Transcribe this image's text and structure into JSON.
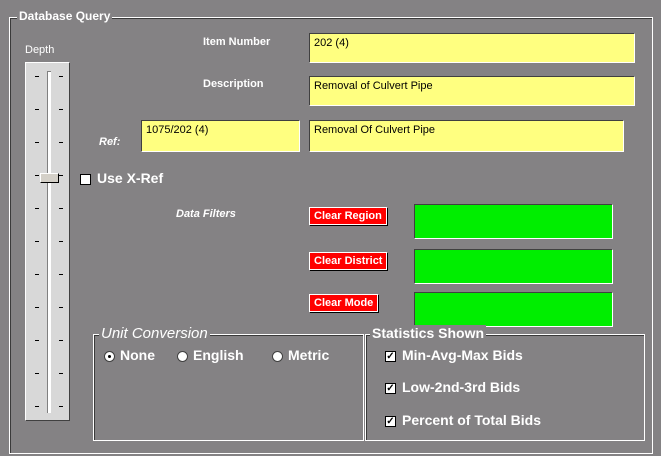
{
  "groups": {
    "database_query": "Database Query",
    "unit_conversion": "Unit Conversion",
    "statistics_shown": "Statistics Shown"
  },
  "slider": {
    "label": "Depth",
    "value_fraction": 0.31
  },
  "item_number": {
    "label": "Item Number",
    "value": "202 (4)"
  },
  "description": {
    "label": "Description",
    "value": "Removal of Culvert Pipe"
  },
  "ref": {
    "label": "Ref:",
    "code": "1075/202 (4)",
    "description": "Removal Of Culvert Pipe"
  },
  "use_xref": {
    "label": "Use X-Ref",
    "checked": false
  },
  "data_filters": {
    "label": "Data Filters",
    "buttons": [
      {
        "label": "Clear Region",
        "value": ""
      },
      {
        "label": "Clear District",
        "value": ""
      },
      {
        "label": "Clear Mode",
        "value": ""
      }
    ]
  },
  "unit_options": [
    {
      "label": "None",
      "selected": true
    },
    {
      "label": "English",
      "selected": false
    },
    {
      "label": "Metric",
      "selected": false
    }
  ],
  "statistics": [
    {
      "label": "Min-Avg-Max Bids",
      "checked": true
    },
    {
      "label": "Low-2nd-3rd Bids",
      "checked": true
    },
    {
      "label": "Percent of Total Bids",
      "checked": true
    }
  ],
  "colors": {
    "background": "#848284",
    "field_yellow": "#ffff80",
    "button_red": "#ff0000",
    "filter_green": "#00ee00"
  }
}
